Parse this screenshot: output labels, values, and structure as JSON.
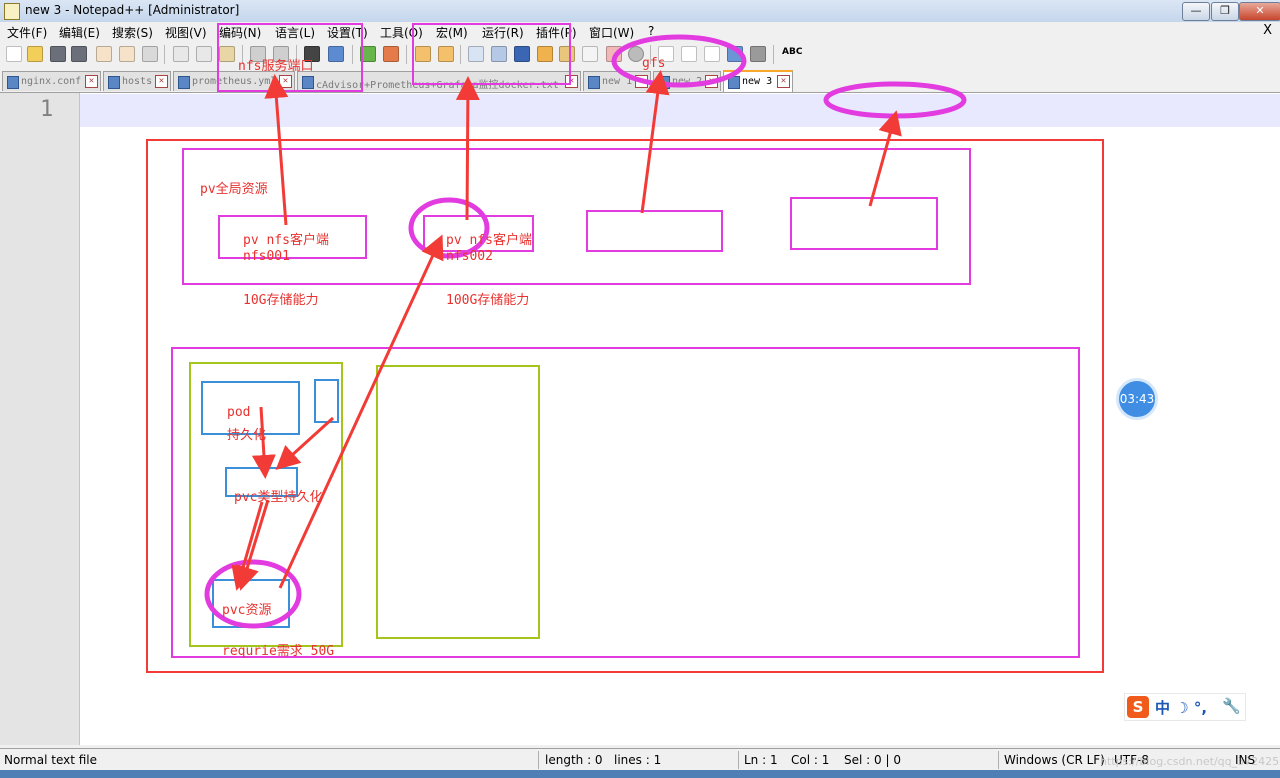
{
  "window": {
    "title": "new 3 - Notepad++ [Administrator]",
    "minimize_label": "—",
    "restore_label": "❐",
    "close_label": "✕"
  },
  "menu": [
    "文件(F)",
    "编辑(E)",
    "搜索(S)",
    "视图(V)",
    "编码(N)",
    "语言(L)",
    "设置(T)",
    "工具(O)",
    "宏(M)",
    "运行(R)",
    "插件(P)",
    "窗口(W)",
    "?"
  ],
  "menu_close": "X",
  "toolbar": {
    "abc_label": "ABC"
  },
  "tabs": [
    {
      "label": "nginx.conf",
      "close": "✕"
    },
    {
      "label": "hosts",
      "close": "✕"
    },
    {
      "label": "prometheus.yml",
      "close": "✕"
    },
    {
      "label": "cAdvisor+Prometheus+Grafana监控docker.txt",
      "close": "✕"
    },
    {
      "label": "new 1",
      "close": "✕"
    },
    {
      "label": "new 2",
      "close": "✕"
    },
    {
      "label": "new 3",
      "close": "✕"
    }
  ],
  "editor": {
    "line_number": "1"
  },
  "annotations": {
    "nfs_port": "nfs服务端口",
    "gfs": "gfs",
    "pv_global": "pv全局资源",
    "pv_client_1": "pv  nfs客户端",
    "nfs001": "nfs001",
    "pv_client_2": "pv nfs客户端",
    "nfs002": "nfs002",
    "cap_10g": "10G存储能力",
    "cap_100g": "100G存储能力",
    "pod": "pod",
    "persist": "持久化",
    "pvc_type": "pvc类型持久化",
    "pvc_res": "pvc资源",
    "require": "requrie需求  50G"
  },
  "timer": "03:43",
  "ime": {
    "logo": "S",
    "chars": "中 ☽ °,",
    "wrench": "🔧"
  },
  "status": {
    "file_type": "Normal text file",
    "length": "length : 0",
    "lines": "lines : 1",
    "ln": "Ln : 1",
    "col": "Col : 1",
    "sel": "Sel : 0 | 0",
    "eol": "Windows (CR LF)",
    "encoding": "UTF-8",
    "watermark": "https://blog.csdn.net/qq_37242520",
    "ins": "INS"
  },
  "colors": {
    "red": "#f23b36",
    "magenta": "#e23ce0",
    "green": "#a4c51c",
    "blue": "#3a8fd8",
    "current_line": "#e8e8ff"
  }
}
